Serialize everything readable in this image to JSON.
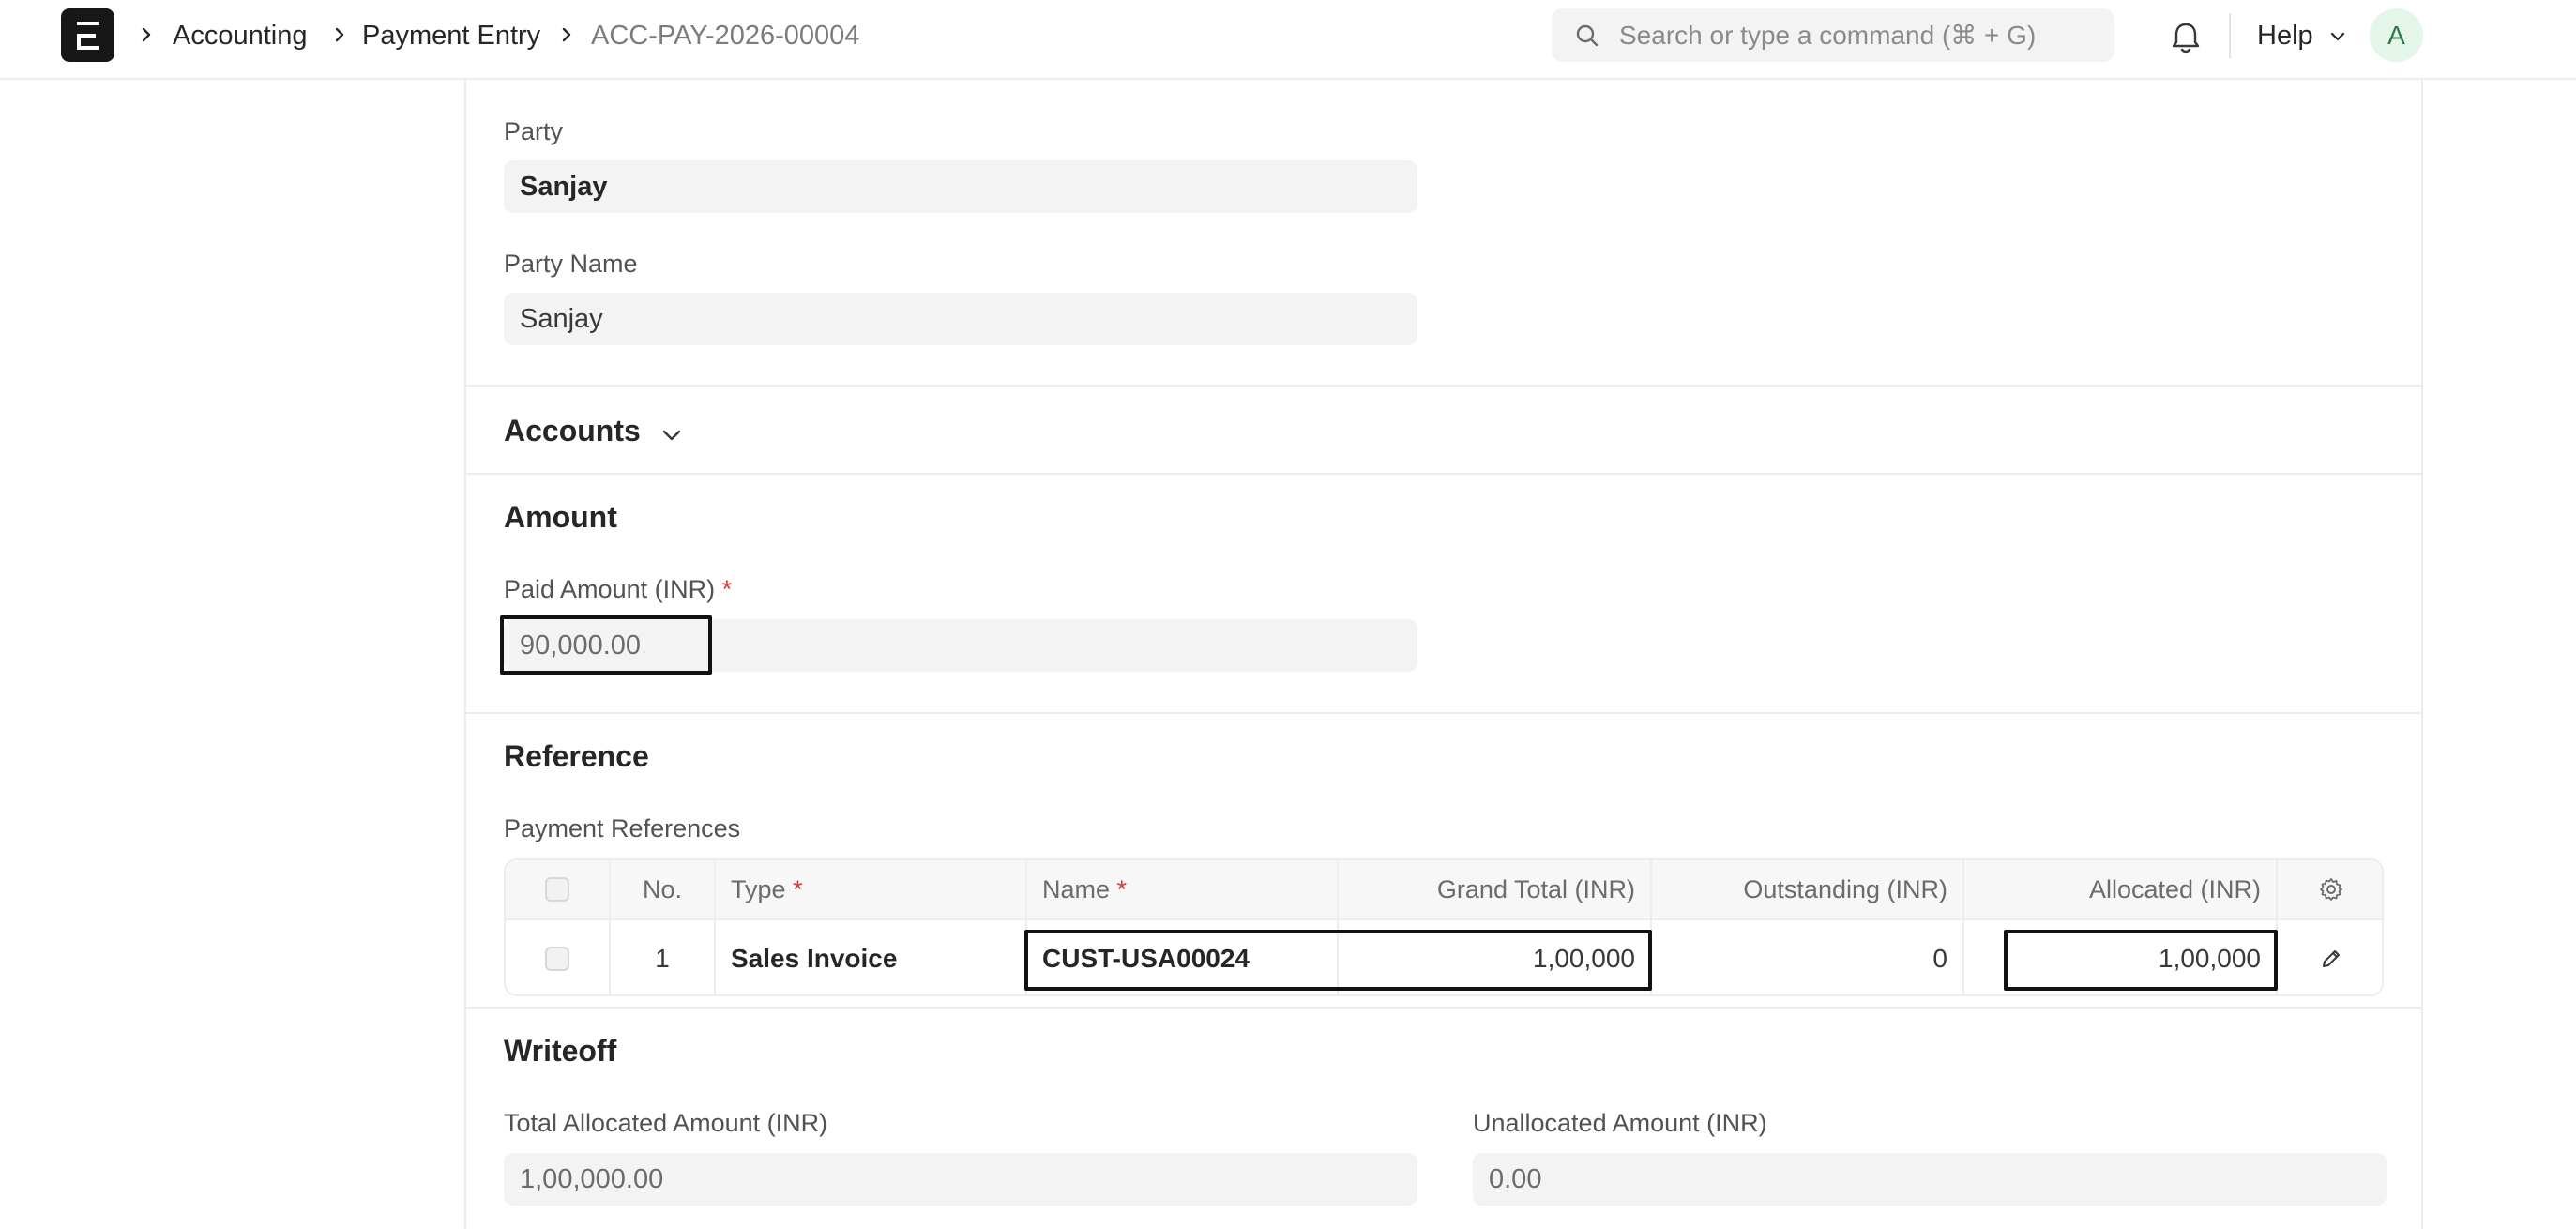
{
  "header": {
    "breadcrumbs": [
      "Accounting",
      "Payment Entry",
      "ACC-PAY-2026-00004"
    ],
    "search_placeholder": "Search or type a command (⌘ + G)",
    "help_label": "Help",
    "avatar_initial": "A"
  },
  "party": {
    "party_label": "Party",
    "party_value": "Sanjay",
    "party_name_label": "Party Name",
    "party_name_value": "Sanjay"
  },
  "accounts": {
    "title": "Accounts"
  },
  "amount": {
    "title": "Amount",
    "paid_amount_label": "Paid Amount (INR)",
    "required_mark": "*",
    "paid_amount_value": "90,000.00"
  },
  "reference": {
    "title": "Reference",
    "table_label": "Payment References",
    "columns": [
      "No.",
      "Type",
      "Name",
      "Grand Total (INR)",
      "Outstanding (INR)",
      "Allocated (INR)"
    ],
    "rows": [
      {
        "no": "1",
        "type": "Sales Invoice",
        "name": "CUST-USA00024",
        "grand_total": "1,00,000",
        "outstanding": "0",
        "allocated": "1,00,000"
      }
    ]
  },
  "writeoff": {
    "title": "Writeoff",
    "total_allocated_label": "Total Allocated Amount (INR)",
    "total_allocated_value": "1,00,000.00",
    "unallocated_label": "Unallocated Amount (INR)",
    "unallocated_value": "0.00"
  },
  "colors": {
    "logo_bg": "#171717",
    "field_bg": "#f3f3f3",
    "required": "#e03636",
    "avatar_bg": "#e4f5e9",
    "avatar_text": "#2f7a4a"
  }
}
